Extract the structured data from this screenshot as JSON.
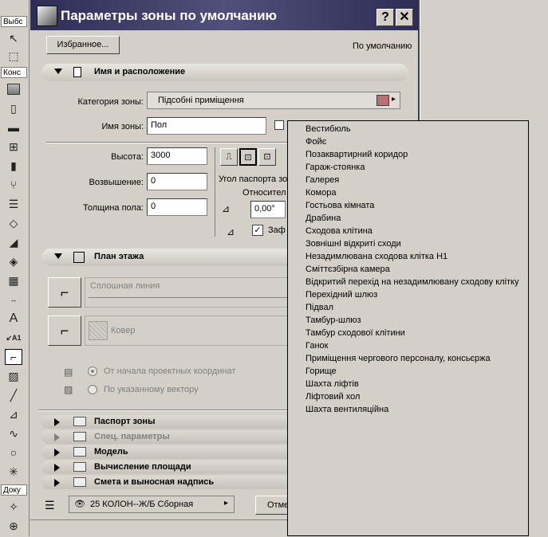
{
  "toolbox": {
    "select_label": "Выбс",
    "construct_label": "Конс",
    "document_label": "Доку"
  },
  "dialog": {
    "title": "Параметры зоны по умолчанию",
    "help_button": "?",
    "close_button": "✕",
    "favorites_button": "Избранное...",
    "default_label": "По умолчанию",
    "name_section": {
      "title": "Имя и расположение",
      "category_label": "Категория зоны:",
      "category_value": "Підсобні приміщення",
      "category_color": "#b87070",
      "name_label": "Имя зоны:",
      "name_value": "Пол",
      "height_label": "Высота:",
      "height_value": "3000",
      "elevation_label": "Возвышение:",
      "elevation_value": "0",
      "floor_thickness_label": "Толщина пола:",
      "floor_thickness_value": "0",
      "stamp_angle_label": "Угол паспорта зо",
      "relative_label": "Относител",
      "angle_value": "0,00°",
      "checkbox_label": "Заф"
    },
    "floor_plan": {
      "title": "План этажа",
      "line_type": "Сплошная линия",
      "fill_type": "Ковер",
      "radio_project": "От начала проектных координат",
      "radio_vector": "По указанному вектору"
    },
    "collapsed_sections": [
      {
        "title": "Паспорт зоны",
        "disabled": false
      },
      {
        "title": "Спец. параметры",
        "disabled": true
      },
      {
        "title": "Модель",
        "disabled": false
      },
      {
        "title": "Вычисление площади",
        "disabled": false
      },
      {
        "title": "Смета и выносная надпись",
        "disabled": false
      }
    ],
    "layer_value": "25 КОЛОН--Ж/Б Сборная",
    "cancel_button": "Отме"
  },
  "dropdown": {
    "items": [
      "Вестибюль",
      "Фойє",
      "Позаквартирний коридор",
      "Гараж-стоянка",
      "Галерея",
      "Комора",
      "Гостьова кімната",
      "Драбина",
      "Сходова клітина",
      "ЗовнішнІ відкриті сходи",
      "Незадимлювана сходова клітка Н1",
      "Сміттєзбірна камера",
      "Відкритий перехід на незадимлювану сходову клітку",
      "Перехідний шлюз",
      "Підвал",
      "Тамбур-шлюз",
      "Тамбур сходової клітини",
      "Ганок",
      "Приміщення чергового персоналу, консьєржа",
      "Горище",
      "Шахта ліфтів",
      "Ліфтовий хол",
      "Шахта вентиляційна"
    ]
  }
}
